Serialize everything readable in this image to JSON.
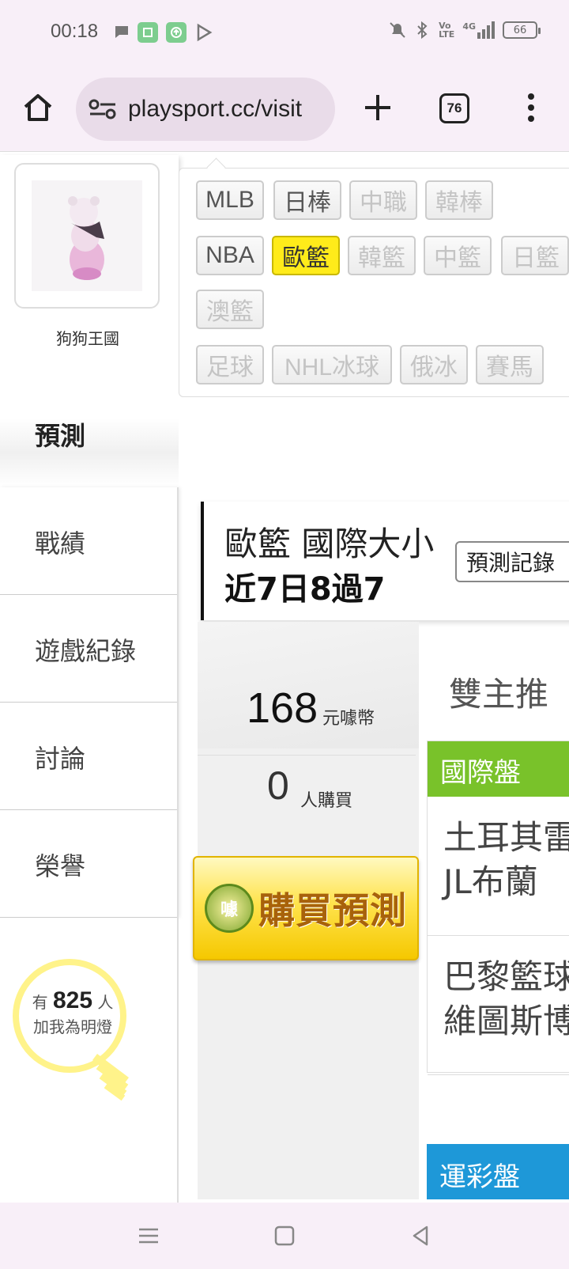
{
  "status_bar": {
    "time": "00:18",
    "network": "4G",
    "battery": "66"
  },
  "browser": {
    "url": "playsport.cc/visit",
    "tab_count": "76"
  },
  "profile": {
    "name": "狗狗王國"
  },
  "sidebar": {
    "active": "預測",
    "items": [
      {
        "label": "戰績"
      },
      {
        "label": "遊戲紀錄"
      },
      {
        "label": "討論"
      },
      {
        "label": "榮譽"
      }
    ],
    "bulb": {
      "prefix": "有",
      "count": "825",
      "suffix": "人",
      "line2": "加我為明燈"
    }
  },
  "categories": [
    {
      "label": "MLB"
    },
    {
      "label": "日棒"
    },
    {
      "label": "中職"
    },
    {
      "label": "韓棒"
    },
    {
      "label": "NBA"
    },
    {
      "label": "歐籃"
    },
    {
      "label": "韓籃"
    },
    {
      "label": "中籃"
    },
    {
      "label": "日籃"
    },
    {
      "label": "澳籃"
    },
    {
      "label": "足球"
    },
    {
      "label": "NHL冰球"
    },
    {
      "label": "俄冰"
    },
    {
      "label": "賽馬"
    }
  ],
  "prediction": {
    "title": "歐籃 國際大小",
    "record": "近7日8過7",
    "record_button": "預測記錄",
    "price": "168",
    "price_unit": "元噱幣",
    "buyers": "0",
    "buyers_unit": "人購買",
    "buy_badge": "噱",
    "buy_label": "購買預測",
    "heading": "雙主推",
    "market1": "國際盤",
    "games": [
      {
        "line1": "土耳其雷",
        "line2": "JL布蘭"
      },
      {
        "line1": "巴黎籃球",
        "line2": "維圖斯博"
      }
    ],
    "market2": "運彩盤"
  },
  "colors": {
    "active_chip": "#ffeb1a",
    "market_green": "#79c22a",
    "market_blue": "#1e98d8",
    "buy_gold": "#ffe34d"
  }
}
